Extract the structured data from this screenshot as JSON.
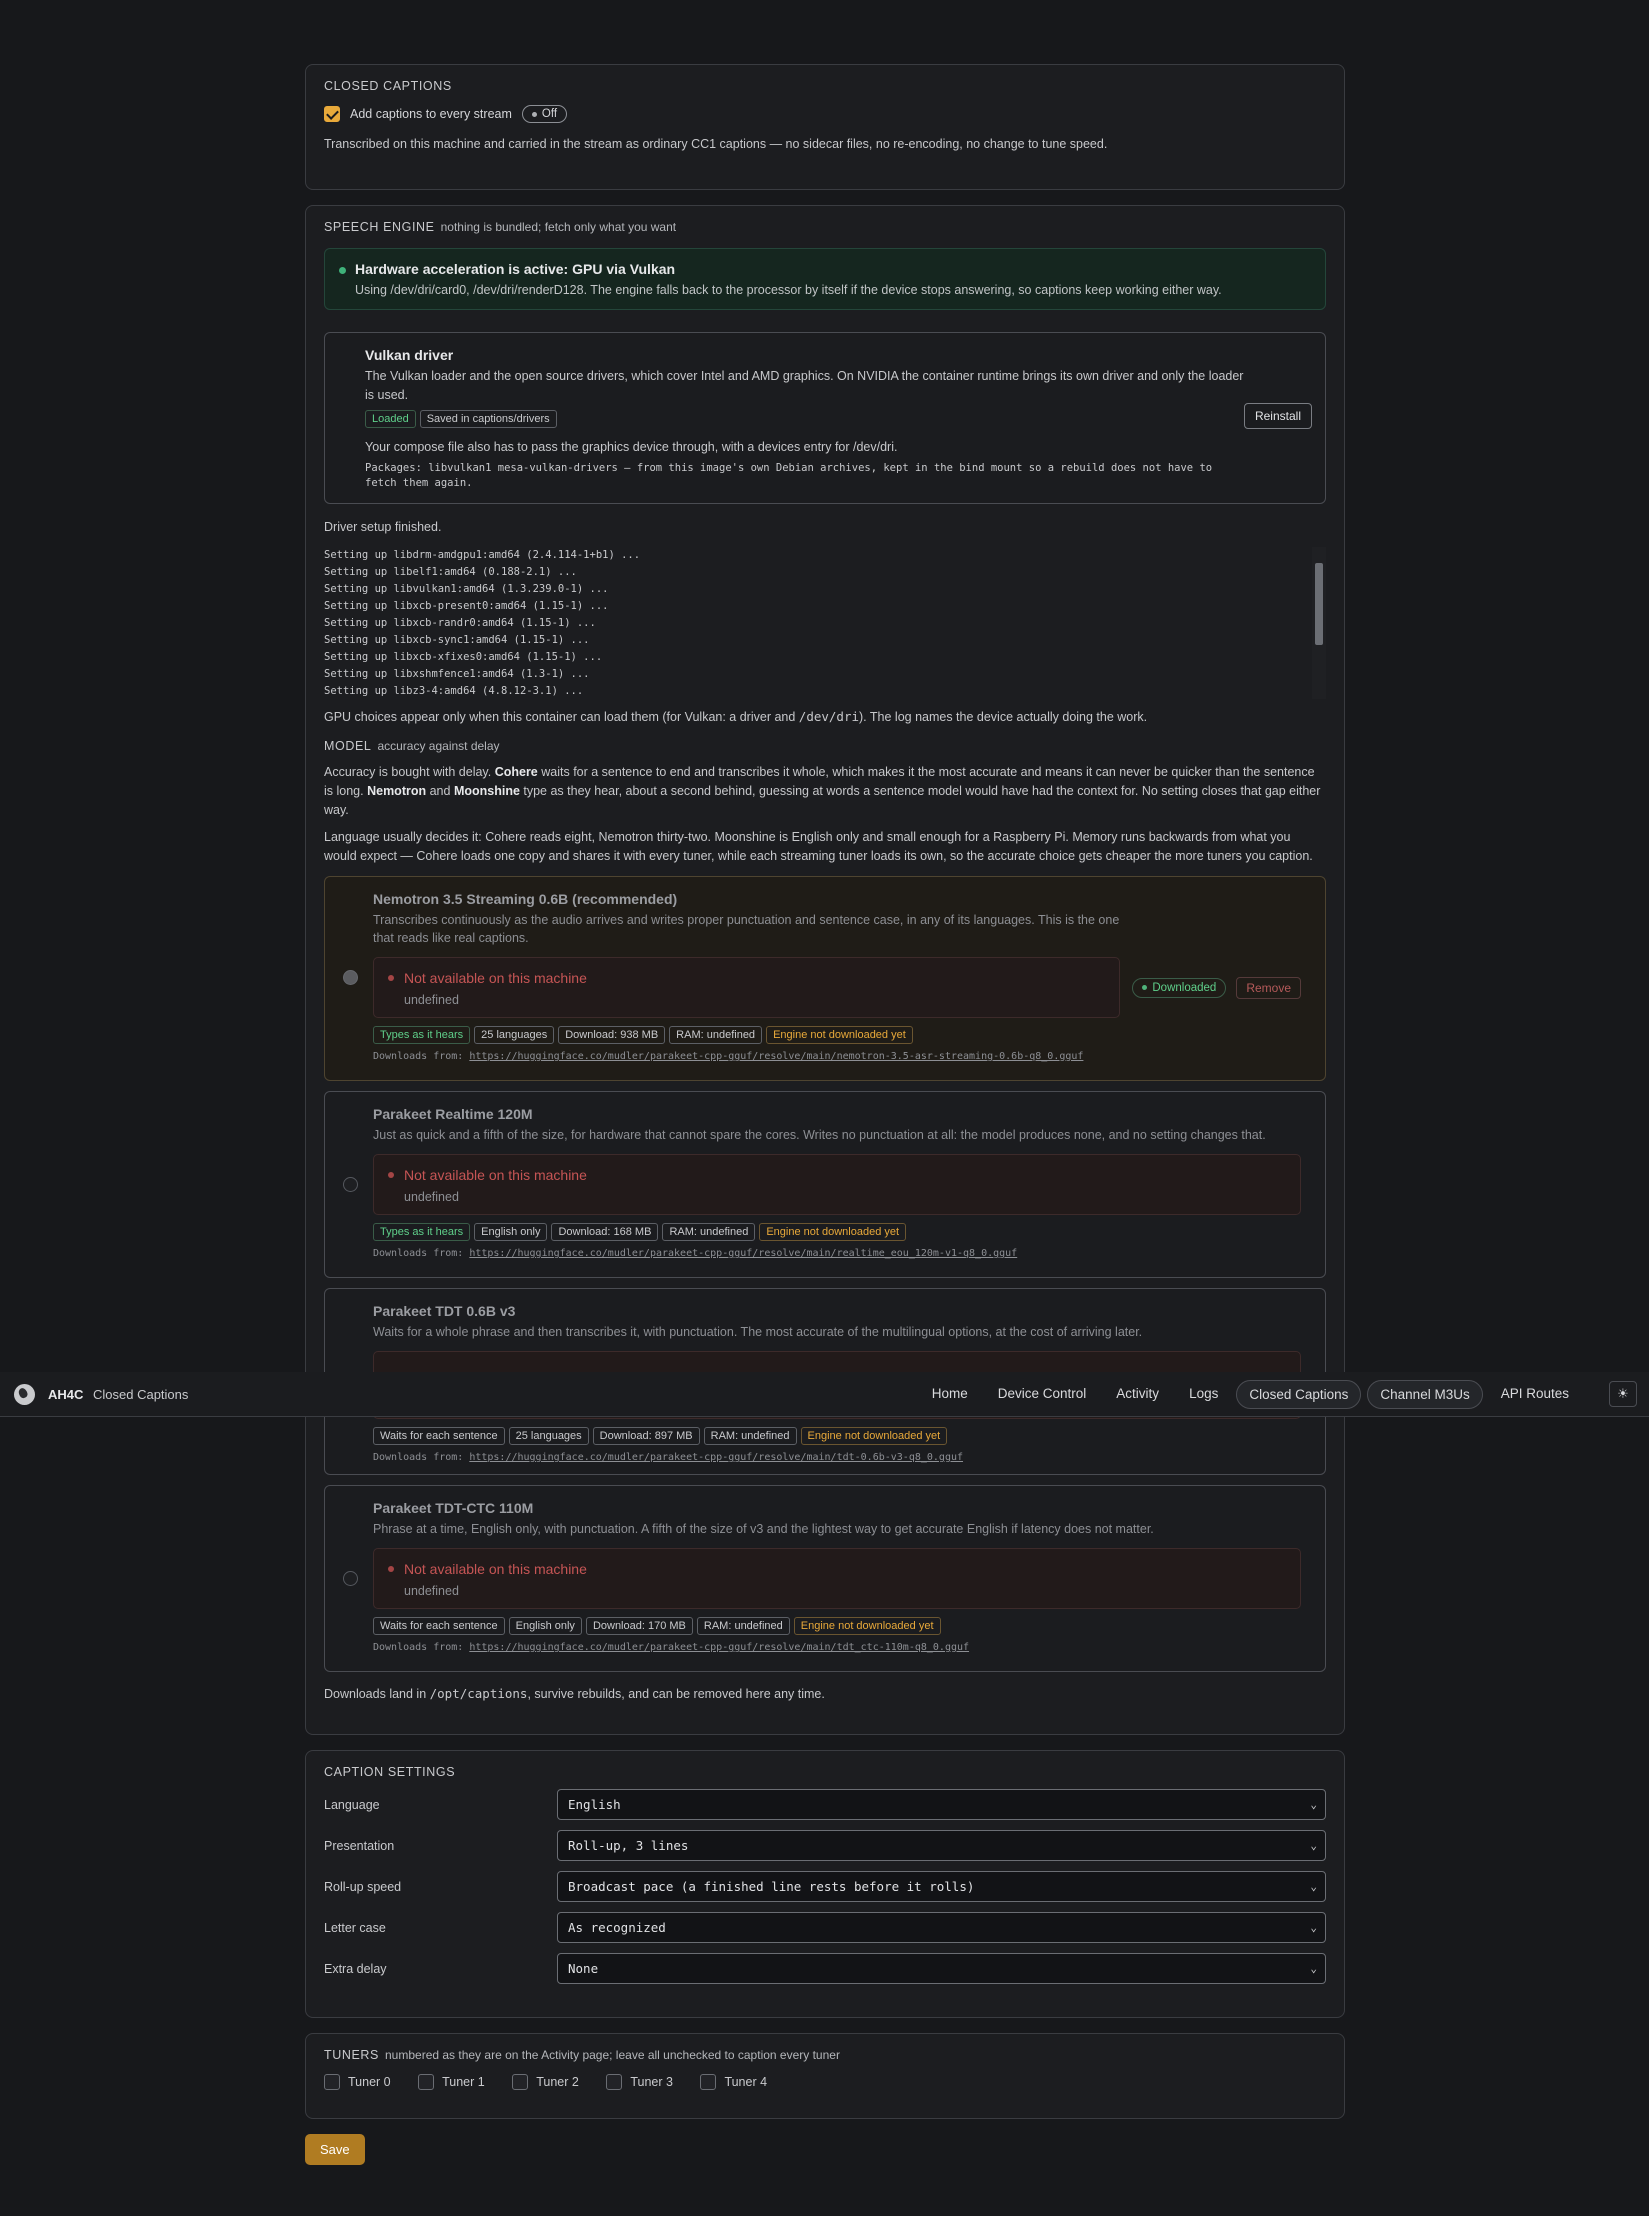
{
  "closed_captions": {
    "title": "Closed Captions",
    "checkbox_label": "Add captions to every stream",
    "status_pill": "Off",
    "description": "Transcribed on this machine and carried in the stream as ordinary CC1 captions — no sidecar files, no re-encoding, no change to tune speed."
  },
  "speech_engine": {
    "title": "Speech Engine",
    "subtitle": "nothing is bundled; fetch only what you want",
    "gpu": {
      "title": "Hardware acceleration is active: GPU via Vulkan",
      "desc": "Using /dev/dri/card0, /dev/dri/renderD128. The engine falls back to the processor by itself if the device stops answering, so captions keep working either way."
    },
    "driver": {
      "title": "Vulkan driver",
      "desc": "The Vulkan loader and the open source drivers, which cover Intel and AMD graphics. On NVIDIA the container runtime brings its own driver and only the loader is used.",
      "tag_loaded": "Loaded",
      "tag_saved": "Saved in captions/drivers",
      "note": "Your compose file also has to pass the graphics device through, with a devices entry for /dev/dri.",
      "packages": "Packages: libvulkan1 mesa-vulkan-drivers — from this image's own Debian archives, kept in the bind mount so a rebuild does not have to fetch them again.",
      "reinstall": "Reinstall"
    },
    "setup_done": "Driver setup finished.",
    "log_lines": [
      "Setting up libdrm-amdgpu1:amd64 (2.4.114-1+b1) ...",
      "Setting up libelf1:amd64 (0.188-2.1) ...",
      "Setting up libvulkan1:amd64 (1.3.239.0-1) ...",
      "Setting up libxcb-present0:amd64 (1.15-1) ...",
      "Setting up libxcb-randr0:amd64 (1.15-1) ...",
      "Setting up libxcb-sync1:amd64 (1.15-1) ...",
      "Setting up libxcb-xfixes0:amd64 (1.15-1) ...",
      "Setting up libxshmfence1:amd64 (1.3-1) ...",
      "Setting up libz3-4:amd64 (4.8.12-3.1) ..."
    ],
    "gpu_note_a": "GPU choices appear only when this container can load them (for Vulkan: a driver and ",
    "gpu_note_code": "/dev/dri",
    "gpu_note_b": "). The log names the device actually doing the work.",
    "model_title": "Model",
    "model_subtitle": "accuracy against delay",
    "model_p1": {
      "a": "Accuracy is bought with delay. ",
      "b": "Cohere",
      "c": " waits for a sentence to end and transcribes it whole, which makes it the most accurate and means it can never be quicker than the sentence is long. ",
      "d": "Nemotron",
      "e": " and ",
      "f": "Moonshine",
      "g": " type as they hear, about a second behind, guessing at words a sentence model would have had the context for. No setting closes that gap either way."
    },
    "model_p2": "Language usually decides it: Cohere reads eight, Nemotron thirty-two. Moonshine is English only and small enough for a Raspberry Pi. Memory runs backwards from what you would expect — Cohere loads one copy and shares it with every tuner, while each streaming tuner loads its own, so the accurate choice gets cheaper the more tuners you caption.",
    "models": [
      {
        "name": "Nemotron 3.5 Streaming 0.6B (recommended)",
        "desc": "Transcribes continuously as the audio arrives and writes proper punctuation and sentence case, in any of its languages. This is the one that reads like real captions.",
        "na_title": "Not available on this machine",
        "na_detail": "undefined",
        "downloaded": "Downloaded",
        "remove": "Remove",
        "tags": [
          "Types as it hears",
          "25 languages",
          "Download: 938 MB",
          "RAM: undefined",
          "Engine not downloaded yet"
        ],
        "url_prefix": "Downloads from: ",
        "url": "https://huggingface.co/mudler/parakeet-cpp-gguf/resolve/main/nemotron-3.5-asr-streaming-0.6b-q8_0.gguf"
      },
      {
        "name": "Parakeet Realtime 120M",
        "desc": "Just as quick and a fifth of the size, for hardware that cannot spare the cores. Writes no punctuation at all: the model produces none, and no setting changes that.",
        "na_title": "Not available on this machine",
        "na_detail": "undefined",
        "tags": [
          "Types as it hears",
          "English only",
          "Download: 168 MB",
          "RAM: undefined",
          "Engine not downloaded yet"
        ],
        "url_prefix": "Downloads from: ",
        "url": "https://huggingface.co/mudler/parakeet-cpp-gguf/resolve/main/realtime_eou_120m-v1-q8_0.gguf"
      },
      {
        "name": "Parakeet TDT 0.6B v3",
        "desc": "Waits for a whole phrase and then transcribes it, with punctuation. The most accurate of the multilingual options, at the cost of arriving later.",
        "tags": [
          "Waits for each sentence",
          "25 languages",
          "Download: 897 MB",
          "RAM: undefined",
          "Engine not downloaded yet"
        ],
        "url_prefix": "Downloads from: ",
        "url": "https://huggingface.co/mudler/parakeet-cpp-gguf/resolve/main/tdt-0.6b-v3-q8_0.gguf"
      },
      {
        "name": "Parakeet TDT-CTC 110M",
        "desc": "Phrase at a time, English only, with punctuation. A fifth of the size of v3 and the lightest way to get accurate English if latency does not matter.",
        "na_title": "Not available on this machine",
        "na_detail": "undefined",
        "tags": [
          "Waits for each sentence",
          "English only",
          "Download: 170 MB",
          "RAM: undefined",
          "Engine not downloaded yet"
        ],
        "url_prefix": "Downloads from: ",
        "url": "https://huggingface.co/mudler/parakeet-cpp-gguf/resolve/main/tdt_ctc-110m-q8_0.gguf"
      }
    ],
    "footer_a": "Downloads land in ",
    "footer_code": "/opt/captions",
    "footer_b": ", survive rebuilds, and can be removed here any time."
  },
  "caption_settings": {
    "title": "Caption Settings",
    "rows": [
      {
        "label": "Language",
        "value": "English"
      },
      {
        "label": "Presentation",
        "value": "Roll-up, 3 lines"
      },
      {
        "label": "Roll-up speed",
        "value": "Broadcast pace (a finished line rests before it rolls)"
      },
      {
        "label": "Letter case",
        "value": "As recognized"
      },
      {
        "label": "Extra delay",
        "value": "None"
      }
    ]
  },
  "tuners": {
    "title": "Tuners",
    "subtitle": "numbered as they are on the Activity page; leave all unchecked to caption every tuner",
    "items": [
      "Tuner 0",
      "Tuner 1",
      "Tuner 2",
      "Tuner 3",
      "Tuner 4"
    ]
  },
  "save_label": "Save",
  "nav": {
    "brand": "AH4C",
    "page": "Closed Captions",
    "links": [
      "Home",
      "Device Control",
      "Activity",
      "Logs",
      "Closed Captions",
      "Channel M3Us",
      "API Routes"
    ],
    "theme_icon": "sun-icon"
  }
}
